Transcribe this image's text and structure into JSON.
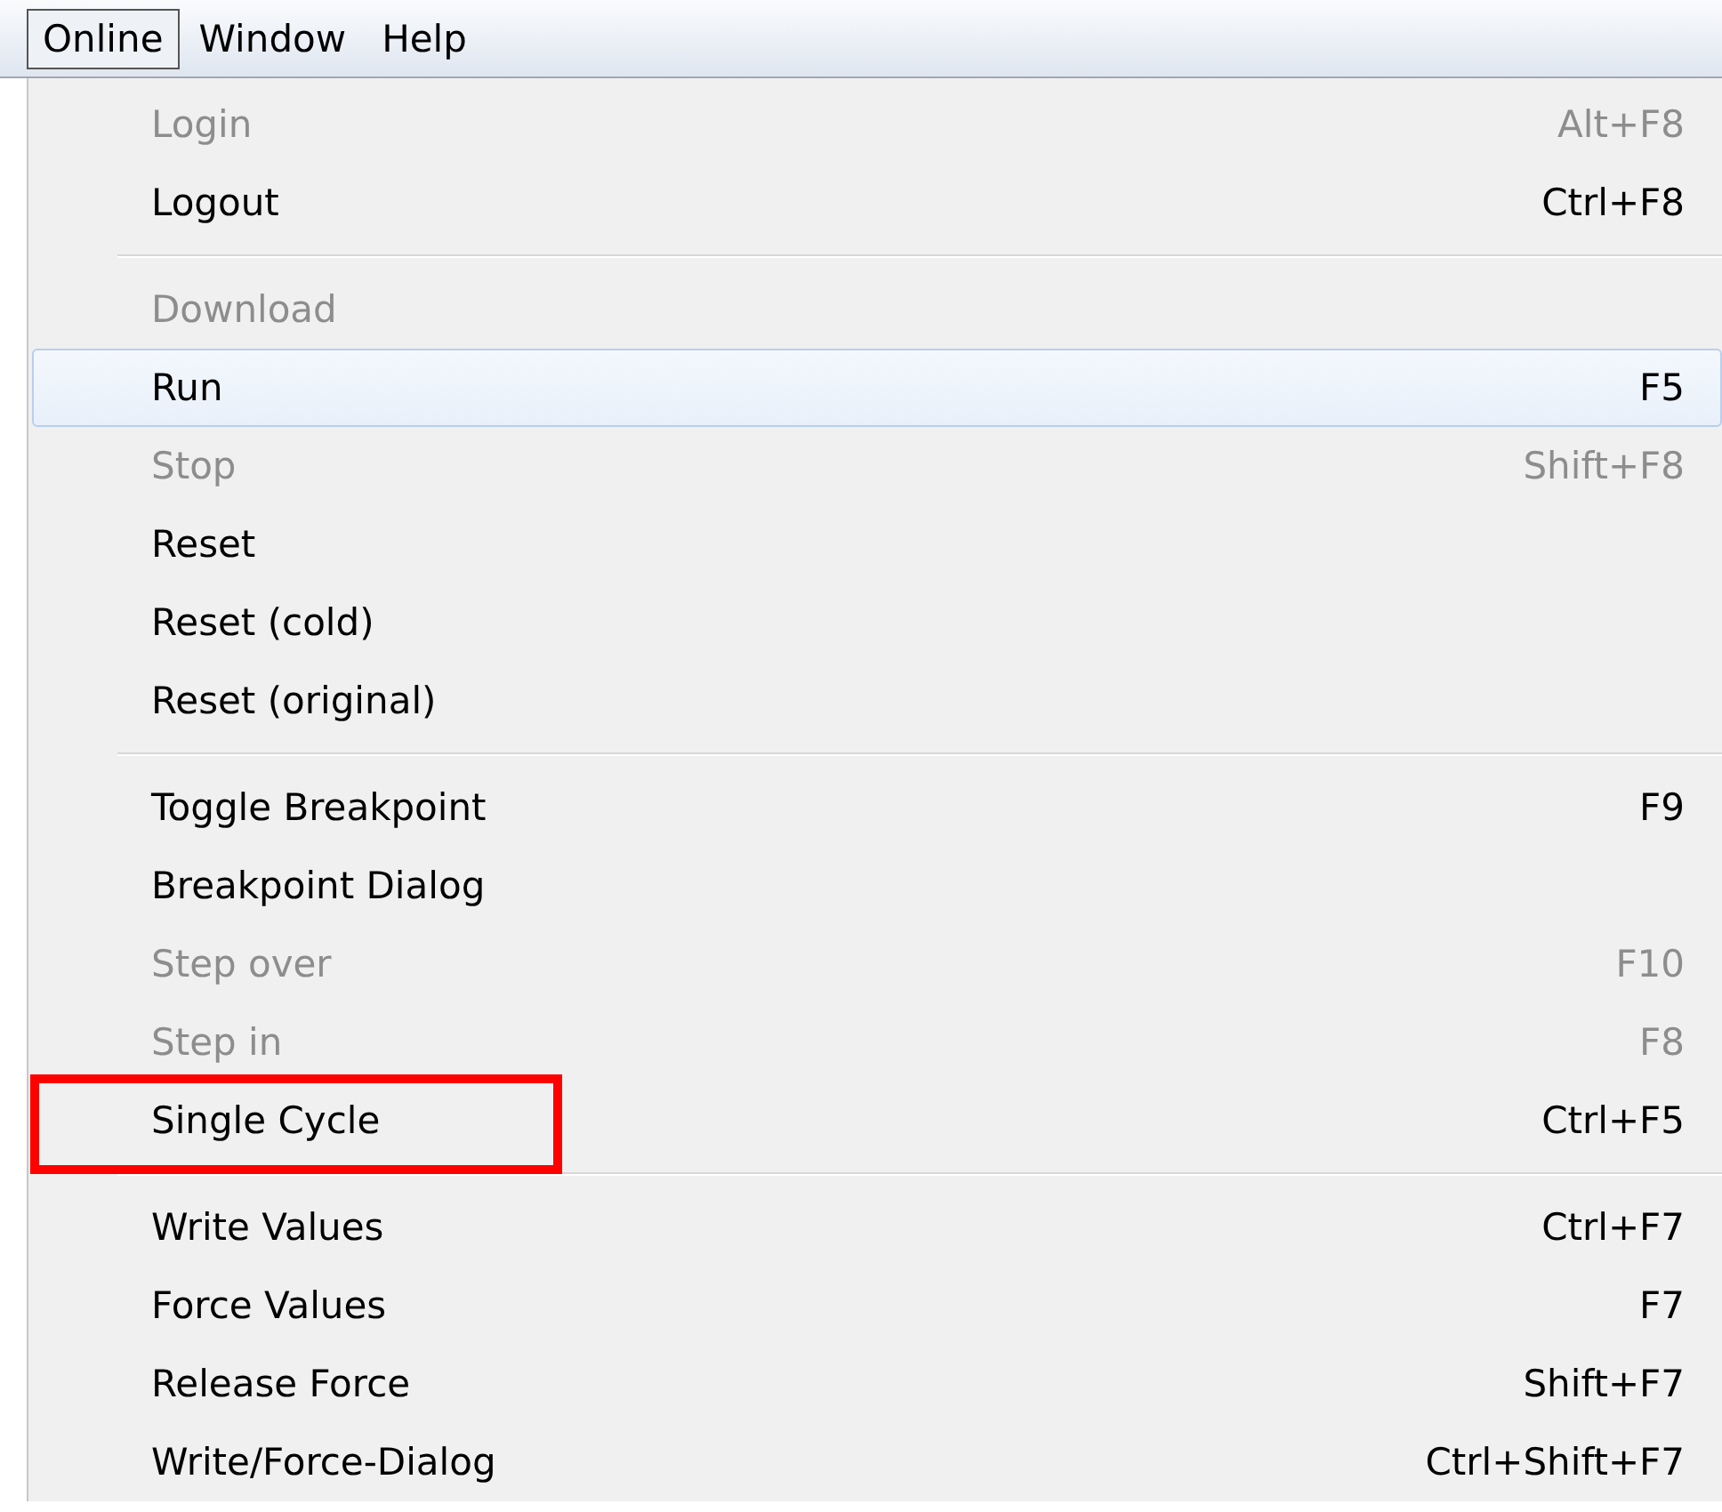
{
  "menubar": [
    {
      "label": "Online",
      "selected": true
    },
    {
      "label": "Window",
      "selected": false
    },
    {
      "label": "Help",
      "selected": false
    }
  ],
  "menu": {
    "groups": [
      {
        "items": [
          {
            "label": "Login",
            "shortcut": "Alt+F8",
            "disabled": true,
            "highlighted": false,
            "annotated": false
          },
          {
            "label": "Logout",
            "shortcut": "Ctrl+F8",
            "disabled": false,
            "highlighted": false,
            "annotated": false
          }
        ]
      },
      {
        "items": [
          {
            "label": "Download",
            "disabled": true,
            "highlighted": false,
            "annotated": false
          },
          {
            "label": "Run",
            "shortcut": "F5",
            "disabled": false,
            "highlighted": true,
            "annotated": false
          },
          {
            "label": "Stop",
            "shortcut": "Shift+F8",
            "disabled": true,
            "highlighted": false,
            "annotated": false
          },
          {
            "label": "Reset",
            "disabled": false,
            "highlighted": false,
            "annotated": false
          },
          {
            "label": "Reset (cold)",
            "disabled": false,
            "highlighted": false,
            "annotated": false
          },
          {
            "label": "Reset (original)",
            "disabled": false,
            "highlighted": false,
            "annotated": false
          }
        ]
      },
      {
        "items": [
          {
            "label": "Toggle Breakpoint",
            "shortcut": "F9",
            "disabled": false,
            "highlighted": false,
            "annotated": false
          },
          {
            "label": "Breakpoint Dialog",
            "disabled": false,
            "highlighted": false,
            "annotated": false
          },
          {
            "label": "Step over",
            "shortcut": "F10",
            "disabled": true,
            "highlighted": false,
            "annotated": false
          },
          {
            "label": "Step in",
            "shortcut": "F8",
            "disabled": true,
            "highlighted": false,
            "annotated": false
          },
          {
            "label": "Single Cycle",
            "shortcut": "Ctrl+F5",
            "disabled": false,
            "highlighted": false,
            "annotated": true
          }
        ]
      },
      {
        "items": [
          {
            "label": "Write Values",
            "shortcut": "Ctrl+F7",
            "disabled": false,
            "highlighted": false,
            "annotated": false
          },
          {
            "label": "Force Values",
            "shortcut": "F7",
            "disabled": false,
            "highlighted": false,
            "annotated": false
          },
          {
            "label": "Release Force",
            "shortcut": "Shift+F7",
            "disabled": false,
            "highlighted": false,
            "annotated": false
          },
          {
            "label": "Write/Force-Dialog",
            "shortcut": "Ctrl+Shift+F7",
            "disabled": false,
            "highlighted": false,
            "annotated": false
          }
        ]
      }
    ]
  }
}
